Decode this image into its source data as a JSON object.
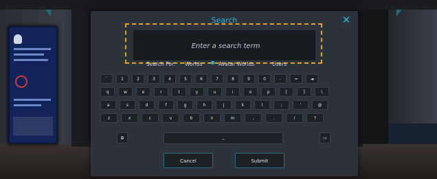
{
  "dialog": {
    "title": "Search",
    "close_glyph": "✕",
    "search_placeholder": "Enter a search term",
    "search_value": ""
  },
  "search_for": {
    "label": "Search For:",
    "options": [
      "Worlds",
      "Avatar Worlds",
      "Users"
    ],
    "selected": "Worlds"
  },
  "keyboard": {
    "row1": [
      "`",
      "1",
      "2",
      "3",
      "4",
      "5",
      "6",
      "7",
      "8",
      "9",
      "0",
      "-",
      "=",
      "◄"
    ],
    "row2": [
      "q",
      "w",
      "e",
      "r",
      "t",
      "y",
      "u",
      "i",
      "o",
      "p",
      "[",
      "]",
      "\\"
    ],
    "row3": [
      "a",
      "s",
      "d",
      "f",
      "g",
      "h",
      "j",
      "k",
      "l",
      ";",
      "'",
      "@"
    ],
    "row4": [
      "z",
      "x",
      "c",
      "v",
      "b",
      "n",
      "m",
      ",",
      ".",
      "/",
      "↑"
    ],
    "copy_icon": "copy-icon",
    "clear_icon": "trash-icon",
    "space_glyph": "⎵"
  },
  "actions": {
    "cancel": "Cancel",
    "submit": "Submit"
  },
  "colors": {
    "accent": "#2ab5d9",
    "highlight": "#e8a020",
    "panel": "#2d333a",
    "key": "#1c2126"
  }
}
